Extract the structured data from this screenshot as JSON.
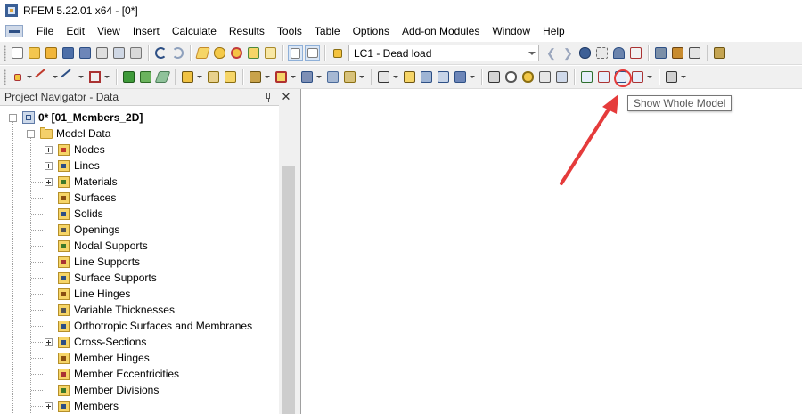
{
  "window": {
    "title": "RFEM 5.22.01 x64 - [0*]"
  },
  "menu": [
    "File",
    "Edit",
    "View",
    "Insert",
    "Calculate",
    "Results",
    "Tools",
    "Table",
    "Options",
    "Add-on Modules",
    "Window",
    "Help"
  ],
  "toolbar": {
    "load_case": "LC1 - Dead load",
    "highlighted_button": "show-whole-model",
    "tooltip": "Show Whole Model"
  },
  "navigator": {
    "title": "Project Navigator - Data",
    "project": "0* [01_Members_2D]",
    "model_data": "Model Data",
    "items": [
      {
        "label": "Nodes",
        "icon": "nodes-icon",
        "expandable": true
      },
      {
        "label": "Lines",
        "icon": "lines-icon",
        "expandable": true
      },
      {
        "label": "Materials",
        "icon": "materials-icon",
        "expandable": true
      },
      {
        "label": "Surfaces",
        "icon": "surfaces-icon",
        "expandable": false
      },
      {
        "label": "Solids",
        "icon": "solids-icon",
        "expandable": false
      },
      {
        "label": "Openings",
        "icon": "openings-icon",
        "expandable": false
      },
      {
        "label": "Nodal Supports",
        "icon": "nodal-supports-icon",
        "expandable": false
      },
      {
        "label": "Line Supports",
        "icon": "line-supports-icon",
        "expandable": false
      },
      {
        "label": "Surface Supports",
        "icon": "surface-supports-icon",
        "expandable": false
      },
      {
        "label": "Line Hinges",
        "icon": "line-hinges-icon",
        "expandable": false
      },
      {
        "label": "Variable Thicknesses",
        "icon": "variable-thicknesses-icon",
        "expandable": false
      },
      {
        "label": "Orthotropic Surfaces and Membranes",
        "icon": "orthotropic-icon",
        "expandable": false
      },
      {
        "label": "Cross-Sections",
        "icon": "cross-sections-icon",
        "expandable": true
      },
      {
        "label": "Member Hinges",
        "icon": "member-hinges-icon",
        "expandable": false
      },
      {
        "label": "Member Eccentricities",
        "icon": "member-eccentricities-icon",
        "expandable": false
      },
      {
        "label": "Member Divisions",
        "icon": "member-divisions-icon",
        "expandable": false
      },
      {
        "label": "Members",
        "icon": "members-icon",
        "expandable": true
      }
    ]
  },
  "colors": {
    "annotation": "#e53b3b",
    "folder": "#f4d06b",
    "accent": "#2d4f85"
  }
}
